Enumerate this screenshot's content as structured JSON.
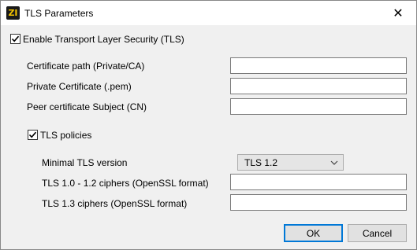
{
  "window": {
    "title": "TLS Parameters",
    "logo_text": "ZI",
    "close_glyph": "✕"
  },
  "enable_tls": {
    "label": "Enable Transport Layer Security (TLS)",
    "checked": true
  },
  "fields": {
    "certificate_path": {
      "label": "Certificate path (Private/CA)",
      "value": ""
    },
    "private_certificate": {
      "label": "Private Certificate (.pem)",
      "value": ""
    },
    "peer_subject": {
      "label": "Peer certificate Subject (CN)",
      "value": ""
    }
  },
  "tls_policies": {
    "label": "TLS policies",
    "checked": true,
    "min_version_label": "Minimal TLS version",
    "min_version_value": "TLS 1.2",
    "ciphers_12_label": "TLS 1.0 - 1.2 ciphers (OpenSSL format)",
    "ciphers_12_value": "",
    "ciphers_13_label": "TLS 1.3 ciphers (OpenSSL format)",
    "ciphers_13_value": ""
  },
  "buttons": {
    "ok": "OK",
    "cancel": "Cancel"
  }
}
